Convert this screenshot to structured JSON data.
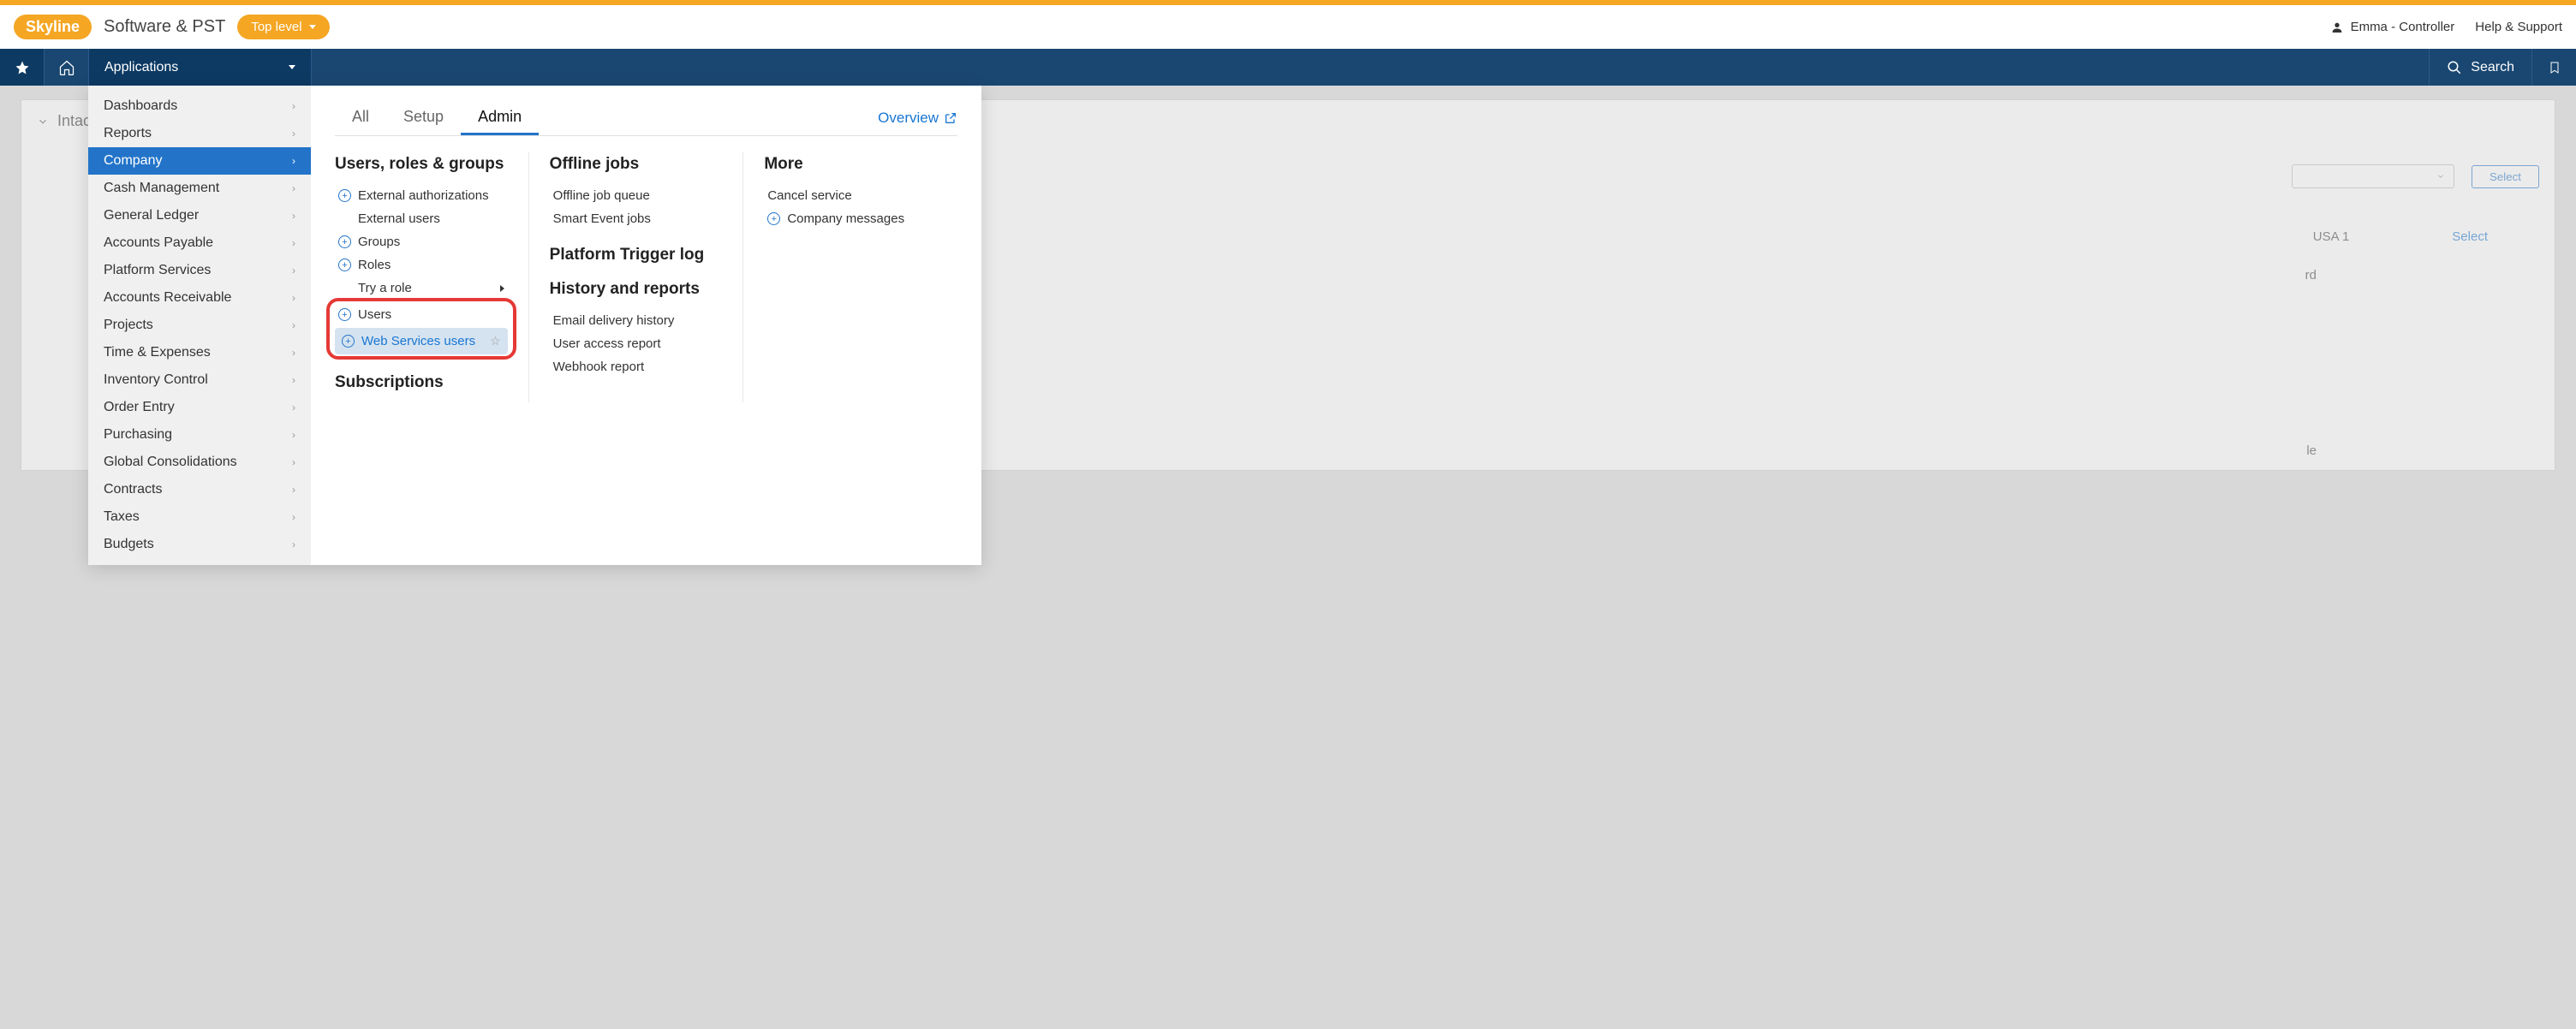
{
  "header": {
    "logo": "Skyline",
    "product": "Software & PST",
    "top_level": "Top level",
    "user": "Emma - Controller",
    "help": "Help & Support"
  },
  "nav": {
    "applications": "Applications",
    "search": "Search"
  },
  "side_menu": [
    {
      "label": "Dashboards"
    },
    {
      "label": "Reports"
    },
    {
      "label": "Company",
      "active": true
    },
    {
      "label": "Cash Management"
    },
    {
      "label": "General Ledger"
    },
    {
      "label": "Accounts Payable"
    },
    {
      "label": "Platform Services"
    },
    {
      "label": "Accounts Receivable"
    },
    {
      "label": "Projects"
    },
    {
      "label": "Time & Expenses"
    },
    {
      "label": "Inventory Control"
    },
    {
      "label": "Order Entry"
    },
    {
      "label": "Purchasing"
    },
    {
      "label": "Global Consolidations"
    },
    {
      "label": "Contracts"
    },
    {
      "label": "Taxes"
    },
    {
      "label": "Budgets"
    }
  ],
  "tabs": {
    "all": "All",
    "setup": "Setup",
    "admin": "Admin",
    "overview": "Overview"
  },
  "col1": {
    "title": "Users, roles & groups",
    "items": {
      "ext_auth": "External authorizations",
      "ext_users": "External users",
      "groups": "Groups",
      "roles": "Roles",
      "try_role": "Try a role",
      "users": "Users",
      "ws_users": "Web Services users"
    },
    "subscriptions": "Subscriptions"
  },
  "col2": {
    "offline_title": "Offline jobs",
    "offline_queue": "Offline job queue",
    "smart_event": "Smart Event jobs",
    "trigger_title": "Platform Trigger log",
    "history_title": "History and reports",
    "email_history": "Email delivery history",
    "user_access": "User access report",
    "webhook": "Webhook report"
  },
  "col3": {
    "more_title": "More",
    "cancel": "Cancel service",
    "messages": "Company messages"
  },
  "bg": {
    "intacct": "Intacct",
    "select": "Select",
    "usa1": "USA 1",
    "select2": "Select",
    "rd": "rd",
    "le": "le"
  }
}
